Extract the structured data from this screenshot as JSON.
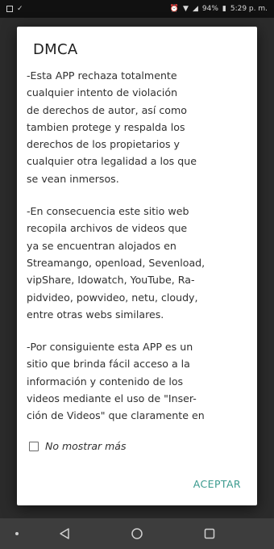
{
  "status_bar": {
    "time": "5:29 p. m.",
    "battery": "94%"
  },
  "dialog": {
    "title": "DMCA",
    "paragraphs": [
      "-Esta APP rechaza totalmente\ncualquier intento de violación\nde derechos de autor, así como\ntambien protege y respalda los\nderechos de los propietarios y\ncualquier otra legalidad a los que\nse vean inmersos.",
      "-En consecuencia este sitio web\nrecopila archivos de videos que\nya se encuentran alojados en\nStreamango, openload, Sevenload,\nvipShare, Idowatch, YouTube, Ra-\npidvideo, powvideo, netu, cloudy,\nentre otras webs similares.",
      "-Por consiguiente esta APP es un\nsitio que brinda fácil acceso a la\ninformación y contenido de los\nvideos mediante el uso de \"Inser-\nción de Videos\" que claramente en"
    ],
    "checkbox_label": "No mostrar más",
    "accept_label": "ACEPTAR"
  },
  "colors": {
    "accent": "#3a9a8e"
  }
}
